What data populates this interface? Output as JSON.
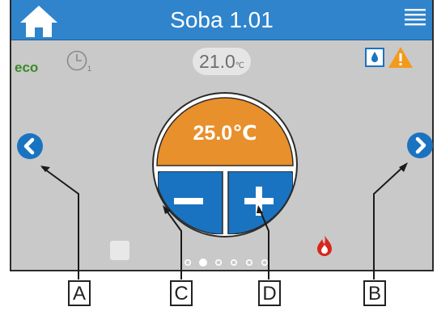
{
  "header": {
    "title": "Soba 1.01"
  },
  "status": {
    "mode": "eco",
    "program_number": "1"
  },
  "room_temperature": {
    "value": "21.0",
    "unit": "℃"
  },
  "setpoint": {
    "value": "25.0℃"
  },
  "pager": {
    "count": 6,
    "active_index": 1
  },
  "callouts": {
    "a": "A",
    "b": "B",
    "c": "C",
    "d": "D"
  },
  "colors": {
    "header": "#2f84cc",
    "button": "#1a73c0",
    "setpoint_bg": "#e8902c",
    "flame": "#d9261c",
    "warning": "#f39a1c",
    "eco": "#3a8b2a"
  }
}
